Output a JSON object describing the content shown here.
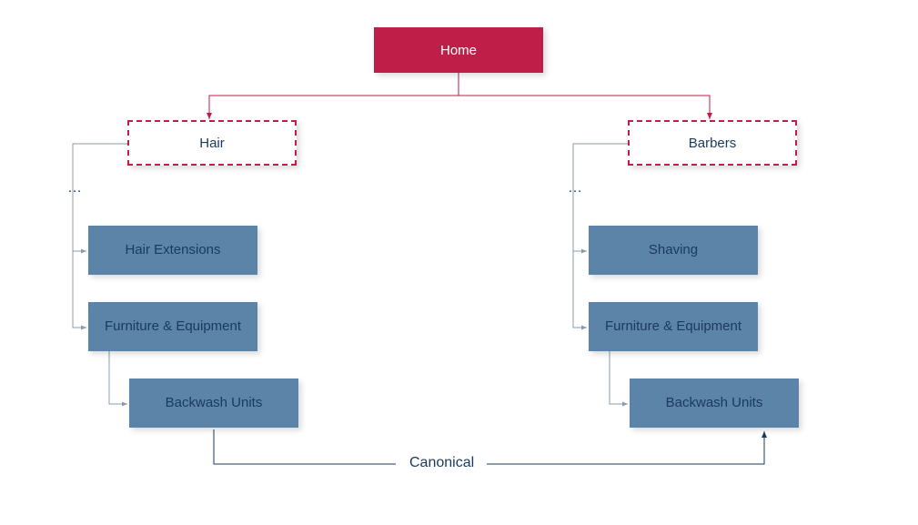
{
  "nodes": {
    "home": "Home",
    "hair": "Hair",
    "barbers": "Barbers",
    "hair_extensions": "Hair Extensions",
    "hair_furniture": "Furniture & Equipment",
    "hair_backwash": "Backwash Units",
    "shaving": "Shaving",
    "barbers_furniture": "Furniture & Equipment",
    "barbers_backwash": "Backwash Units"
  },
  "labels": {
    "ellipsis": "…",
    "canonical": "Canonical"
  },
  "colors": {
    "crimson": "#be1e48",
    "steelblue": "#5c84a8",
    "navy": "#1a3a5c"
  }
}
